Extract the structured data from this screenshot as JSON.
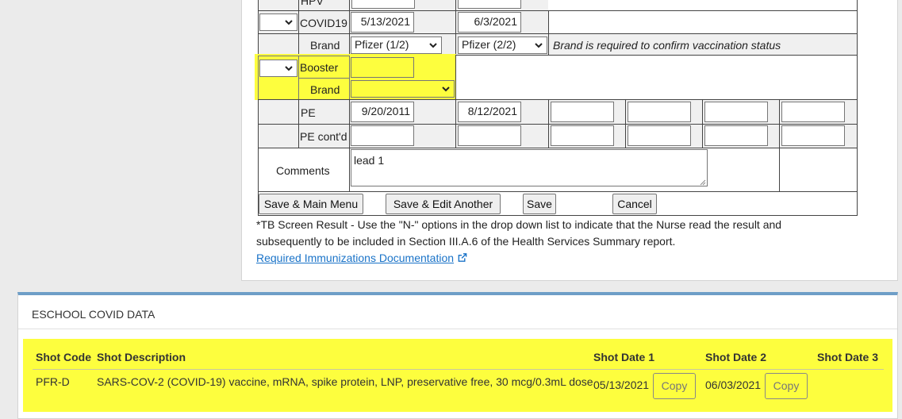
{
  "form": {
    "row_hpv": {
      "label": "HPV"
    },
    "row_covid": {
      "label": "COVID19",
      "dose1": "5/13/2021",
      "dose2": "6/3/2021"
    },
    "row_covid_brand": {
      "label": "Brand",
      "brand1": "Pfizer (1/2)",
      "brand2": "Pfizer (2/2)",
      "note": "Brand is required to confirm vaccination status"
    },
    "row_booster": {
      "label": "Booster",
      "value": ""
    },
    "row_booster_brand": {
      "label": "Brand",
      "value": ""
    },
    "row_pe": {
      "label": "PE",
      "d1": "9/20/2011",
      "d2": "8/12/2021"
    },
    "row_pe_contd": {
      "label": "PE cont'd"
    },
    "comments": {
      "label": "Comments",
      "value": "lead 1"
    },
    "buttons": {
      "save_main": "Save & Main Menu",
      "save_edit": "Save  & Edit Another",
      "save": "Save",
      "cancel": "Cancel"
    },
    "footnote_line1": "*TB Screen Result - Use the \"N-\" options in the drop down list to indicate that the Nurse read the result and",
    "footnote_line2": "subsequently to be included in Section III.A.6 of the Health Services Summary report.",
    "doc_link": "Required Immunizations Documentation"
  },
  "covid_panel": {
    "title": "ESCHOOL COVID DATA",
    "headers": {
      "code": "Shot Code",
      "desc": "Shot Description",
      "date1": "Shot Date 1",
      "date2": "Shot Date 2",
      "date3": "Shot Date 3"
    },
    "row": {
      "code": "PFR-D",
      "desc": "SARS-COV-2 (COVID-19) vaccine, mRNA, spike protein, LNP, preservative free, 30 mcg/0.3mL dose",
      "date1": "05/13/2021",
      "date2": "06/03/2021",
      "copy_label": "Copy"
    }
  },
  "colors": {
    "highlight": "#fdfe3e",
    "link": "#1a73c8",
    "panel_accent": "#6e9ec7"
  },
  "icons": [
    "chevron-down-icon",
    "external-link-icon"
  ]
}
